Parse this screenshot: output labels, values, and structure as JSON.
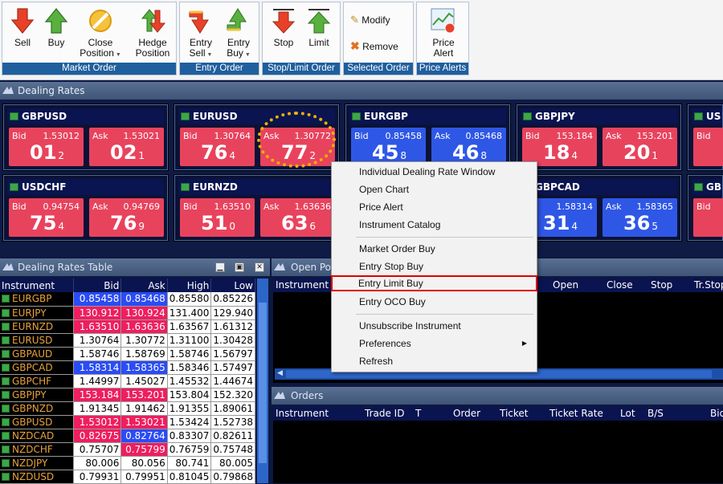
{
  "toolbar": {
    "groups": [
      {
        "label": "Market Order",
        "buttons": [
          {
            "label1": "Sell",
            "label2": ""
          },
          {
            "label1": "Buy",
            "label2": ""
          },
          {
            "label1": "Close",
            "label2": "Position"
          },
          {
            "label1": "Hedge",
            "label2": "Position"
          }
        ]
      },
      {
        "label": "Entry Order",
        "buttons": [
          {
            "label1": "Entry",
            "label2": "Sell"
          },
          {
            "label1": "Entry",
            "label2": "Buy"
          }
        ]
      },
      {
        "label": "Stop/Limit Order",
        "buttons": [
          {
            "label1": "Stop",
            "label2": ""
          },
          {
            "label1": "Limit",
            "label2": ""
          }
        ]
      },
      {
        "label": "Selected Order",
        "buttons": [
          {
            "label1": "Modify",
            "label2": ""
          },
          {
            "label1": "Remove",
            "label2": ""
          }
        ]
      },
      {
        "label": "Price Alerts",
        "buttons": [
          {
            "label1": "Price",
            "label2": "Alert"
          }
        ]
      }
    ]
  },
  "dealing_rates": {
    "title": "Dealing Rates",
    "tiles": [
      {
        "symbol": "GBPUSD",
        "bid_label": "Bid",
        "bid": "1.53012",
        "bid_big": "01",
        "bid_sup": "2",
        "ask_label": "Ask",
        "ask": "1.53021",
        "ask_big": "02",
        "ask_sup": "1"
      },
      {
        "symbol": "EURUSD",
        "bid_label": "Bid",
        "bid": "1.30764",
        "bid_big": "76",
        "bid_sup": "4",
        "ask_label": "Ask",
        "ask": "1.30772",
        "ask_big": "77",
        "ask_sup": "2"
      },
      {
        "symbol": "EURGBP",
        "bid_label": "Bid",
        "bid": "0.85458",
        "bid_big": "45",
        "bid_sup": "8",
        "ask_label": "Ask",
        "ask": "0.85468",
        "ask_big": "46",
        "ask_sup": "8"
      },
      {
        "symbol": "GBPJPY",
        "bid_label": "Bid",
        "bid": "153.184",
        "bid_big": "18",
        "bid_sup": "4",
        "ask_label": "Ask",
        "ask": "153.201",
        "ask_big": "20",
        "ask_sup": "1"
      },
      {
        "symbol": "US",
        "bid_label": "Bid",
        "bid": "",
        "bid_big": "",
        "bid_sup": "",
        "ask_label": "",
        "ask": "",
        "ask_big": "",
        "ask_sup": ""
      },
      {
        "symbol": "USDCHF",
        "bid_label": "Bid",
        "bid": "0.94754",
        "bid_big": "75",
        "bid_sup": "4",
        "ask_label": "Ask",
        "ask": "0.94769",
        "ask_big": "76",
        "ask_sup": "9"
      },
      {
        "symbol": "EURNZD",
        "bid_label": "Bid",
        "bid": "1.63510",
        "bid_big": "51",
        "bid_sup": "0",
        "ask_label": "Ask",
        "ask": "1.63636",
        "ask_big": "63",
        "ask_sup": "6"
      },
      {
        "symbol": "",
        "bid_label": "",
        "bid": "",
        "bid_big": "",
        "bid_sup": "",
        "ask_label": "",
        "ask": "",
        "ask_big": "",
        "ask_sup": ""
      },
      {
        "symbol": "GBPCAD",
        "bid_label": "",
        "bid": "1.58314",
        "bid_big": "31",
        "bid_sup": "4",
        "ask_label": "Ask",
        "ask": "1.58365",
        "ask_big": "36",
        "ask_sup": "5"
      },
      {
        "symbol": "GB",
        "bid_label": "Bid",
        "bid": "",
        "bid_big": "",
        "bid_sup": "",
        "ask_label": "",
        "ask": "",
        "ask_big": "",
        "ask_sup": ""
      }
    ]
  },
  "rates_table": {
    "title": "Dealing Rates Table",
    "columns": [
      "Instrument",
      "Bid",
      "Ask",
      "High",
      "Low"
    ],
    "rows": [
      {
        "inst": "EURGBP",
        "bid": "0.85458",
        "ask": "0.85468",
        "high": "0.85580",
        "low": "0.85226",
        "bid_c": "blue",
        "ask_c": "blue"
      },
      {
        "inst": "EURJPY",
        "bid": "130.912",
        "ask": "130.924",
        "high": "131.400",
        "low": "129.940",
        "bid_c": "red",
        "ask_c": "red"
      },
      {
        "inst": "EURNZD",
        "bid": "1.63510",
        "ask": "1.63636",
        "high": "1.63567",
        "low": "1.61312",
        "bid_c": "red",
        "ask_c": "red"
      },
      {
        "inst": "EURUSD",
        "bid": "1.30764",
        "ask": "1.30772",
        "high": "1.31100",
        "low": "1.30428",
        "bid_c": "",
        "ask_c": ""
      },
      {
        "inst": "GBPAUD",
        "bid": "1.58746",
        "ask": "1.58769",
        "high": "1.58746",
        "low": "1.56797",
        "bid_c": "",
        "ask_c": ""
      },
      {
        "inst": "GBPCAD",
        "bid": "1.58314",
        "ask": "1.58365",
        "high": "1.58346",
        "low": "1.57497",
        "bid_c": "blue",
        "ask_c": "blue"
      },
      {
        "inst": "GBPCHF",
        "bid": "1.44997",
        "ask": "1.45027",
        "high": "1.45532",
        "low": "1.44674",
        "bid_c": "",
        "ask_c": ""
      },
      {
        "inst": "GBPJPY",
        "bid": "153.184",
        "ask": "153.201",
        "high": "153.804",
        "low": "152.320",
        "bid_c": "red",
        "ask_c": "red"
      },
      {
        "inst": "GBPNZD",
        "bid": "1.91345",
        "ask": "1.91462",
        "high": "1.91355",
        "low": "1.89061",
        "bid_c": "",
        "ask_c": ""
      },
      {
        "inst": "GBPUSD",
        "bid": "1.53012",
        "ask": "1.53021",
        "high": "1.53424",
        "low": "1.52738",
        "bid_c": "red",
        "ask_c": "red"
      },
      {
        "inst": "NZDCAD",
        "bid": "0.82675",
        "ask": "0.82764",
        "high": "0.83307",
        "low": "0.82611",
        "bid_c": "red",
        "ask_c": "blue"
      },
      {
        "inst": "NZDCHF",
        "bid": "0.75707",
        "ask": "0.75799",
        "high": "0.76759",
        "low": "0.75748",
        "bid_c": "",
        "ask_c": "red"
      },
      {
        "inst": "NZDJPY",
        "bid": "80.006",
        "ask": "80.056",
        "high": "80.741",
        "low": "80.005",
        "bid_c": "",
        "ask_c": ""
      },
      {
        "inst": "NZDUSD",
        "bid": "0.79931",
        "ask": "0.79951",
        "high": "0.81045",
        "low": "0.79868",
        "bid_c": "",
        "ask_c": ""
      }
    ]
  },
  "open_positions": {
    "title": "Open Po",
    "col_instrument": "Instrument",
    "col_open": "Open",
    "col_close": "Close",
    "col_stop": "Stop",
    "col_trstop": "Tr.Stop"
  },
  "orders": {
    "title": "Orders",
    "columns": [
      "Instrument",
      "Trade ID",
      "T",
      "Order",
      "Ticket",
      "Ticket Rate",
      "Lot",
      "B/S",
      "Bid"
    ]
  },
  "context_menu": {
    "items": [
      "Individual Dealing Rate Window",
      "Open Chart",
      "Price Alert",
      "Instrument Catalog",
      "Market Order Buy",
      "Entry Stop Buy",
      "Entry Limit Buy",
      "Entry OCO Buy",
      "Unsubscribe Instrument",
      "Preferences",
      "Refresh"
    ],
    "highlighted": "Entry Limit Buy"
  },
  "colors": {
    "bid_red": "#e8435d",
    "ask_blue": "#2f57e6",
    "group_label": "#1f5f9e",
    "highlight_border": "#e00000",
    "callout": "#f0b000"
  }
}
